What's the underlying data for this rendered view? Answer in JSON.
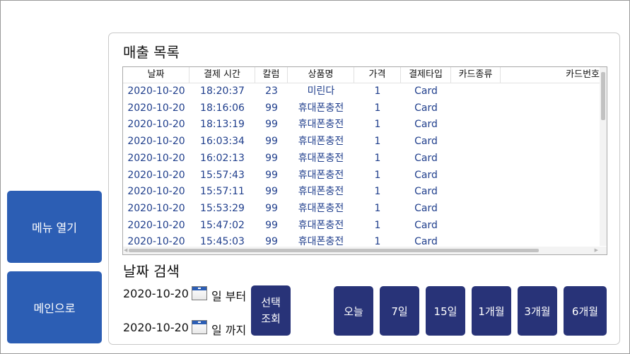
{
  "sidebar": {
    "menu_label": "메뉴 열기",
    "main_label": "메인으로"
  },
  "sales": {
    "title": "매출 목록",
    "columns": [
      "날짜",
      "결제 시간",
      "칼럼",
      "상품명",
      "가격",
      "결제타입",
      "카드종류",
      "카드번호"
    ],
    "rows": [
      [
        "2020-10-20",
        "18:20:37",
        "23",
        "미린다",
        "1",
        "Card"
      ],
      [
        "2020-10-20",
        "18:16:06",
        "99",
        "휴대폰충전",
        "1",
        "Card"
      ],
      [
        "2020-10-20",
        "18:13:19",
        "99",
        "휴대폰충전",
        "1",
        "Card"
      ],
      [
        "2020-10-20",
        "16:03:34",
        "99",
        "휴대폰충전",
        "1",
        "Card"
      ],
      [
        "2020-10-20",
        "16:02:13",
        "99",
        "휴대폰충전",
        "1",
        "Card"
      ],
      [
        "2020-10-20",
        "15:57:43",
        "99",
        "휴대폰충전",
        "1",
        "Card"
      ],
      [
        "2020-10-20",
        "15:57:11",
        "99",
        "휴대폰충전",
        "1",
        "Card"
      ],
      [
        "2020-10-20",
        "15:53:29",
        "99",
        "휴대폰충전",
        "1",
        "Card"
      ],
      [
        "2020-10-20",
        "15:47:02",
        "99",
        "휴대폰충전",
        "1",
        "Card"
      ],
      [
        "2020-10-20",
        "15:45:03",
        "99",
        "휴대폰충전",
        "1",
        "Card"
      ]
    ]
  },
  "search": {
    "title": "날짜 검색",
    "from_date": "2020-10-20",
    "from_suffix": "일 부터",
    "to_date": "2020-10-20",
    "to_suffix": "일 까지",
    "query_label_line1": "선택",
    "query_label_line2": "조회",
    "quick_ranges": [
      "오늘",
      "7일",
      "15일",
      "1개월",
      "3개월",
      "6개월"
    ]
  },
  "colors": {
    "side_button": "#2c5eb4",
    "query_button": "#283378",
    "grid_text": "#1f3e8c",
    "calendar_icon_bar": "#2c5eb4"
  },
  "icons": {
    "calendar": "calendar-icon"
  }
}
